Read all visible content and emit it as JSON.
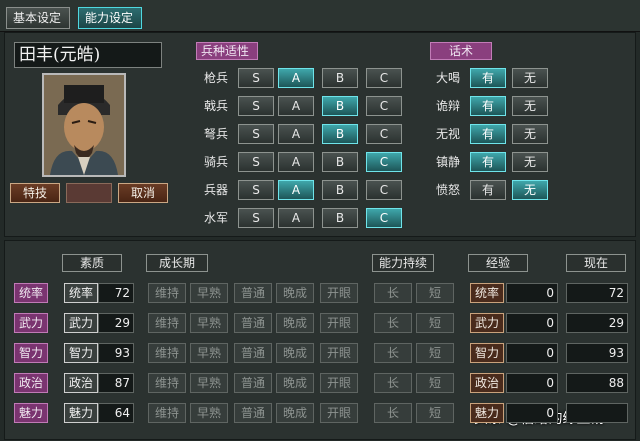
{
  "tabs": {
    "basic": "基本设定",
    "ability": "能力设定"
  },
  "officer": {
    "name": "田丰(元皓)"
  },
  "buttons": {
    "skill": "特技",
    "cancel": "取消"
  },
  "troops": {
    "title": "兵种适性",
    "options": [
      "S",
      "A",
      "B",
      "C"
    ],
    "rows": [
      {
        "label": "枪兵",
        "selected": "A"
      },
      {
        "label": "戟兵",
        "selected": "B"
      },
      {
        "label": "弩兵",
        "selected": "B"
      },
      {
        "label": "骑兵",
        "selected": "C"
      },
      {
        "label": "兵器",
        "selected": "A"
      },
      {
        "label": "水军",
        "selected": "C"
      }
    ]
  },
  "speech": {
    "title": "话术",
    "options": [
      "有",
      "无"
    ],
    "rows": [
      {
        "label": "大喝",
        "selected": "有"
      },
      {
        "label": "诡辩",
        "selected": "有"
      },
      {
        "label": "无视",
        "selected": "有"
      },
      {
        "label": "镇静",
        "selected": "有"
      },
      {
        "label": "愤怒",
        "selected": "无"
      }
    ]
  },
  "stats_headers": {
    "quality": "素质",
    "growth": "成长期",
    "sustain": "能力持续",
    "experience": "经验",
    "current": "现在"
  },
  "growth_options": [
    "维持",
    "早熟",
    "普通",
    "晚成",
    "开眼"
  ],
  "sustain_options": [
    "长",
    "短"
  ],
  "stats": [
    {
      "label": "统率",
      "name": "统率",
      "value": "72",
      "exp_name": "统率",
      "exp": "0",
      "current": "72"
    },
    {
      "label": "武力",
      "name": "武力",
      "value": "29",
      "exp_name": "武力",
      "exp": "0",
      "current": "29"
    },
    {
      "label": "智力",
      "name": "智力",
      "value": "93",
      "exp_name": "智力",
      "exp": "0",
      "current": "93"
    },
    {
      "label": "政治",
      "name": "政治",
      "value": "87",
      "exp_name": "政治",
      "exp": "0",
      "current": "88"
    },
    {
      "label": "魅力",
      "name": "魅力",
      "value": "64",
      "exp_name": "魅力",
      "exp": "0",
      "current": ""
    }
  ],
  "watermark": "头条 @伯给的绿豆饧"
}
